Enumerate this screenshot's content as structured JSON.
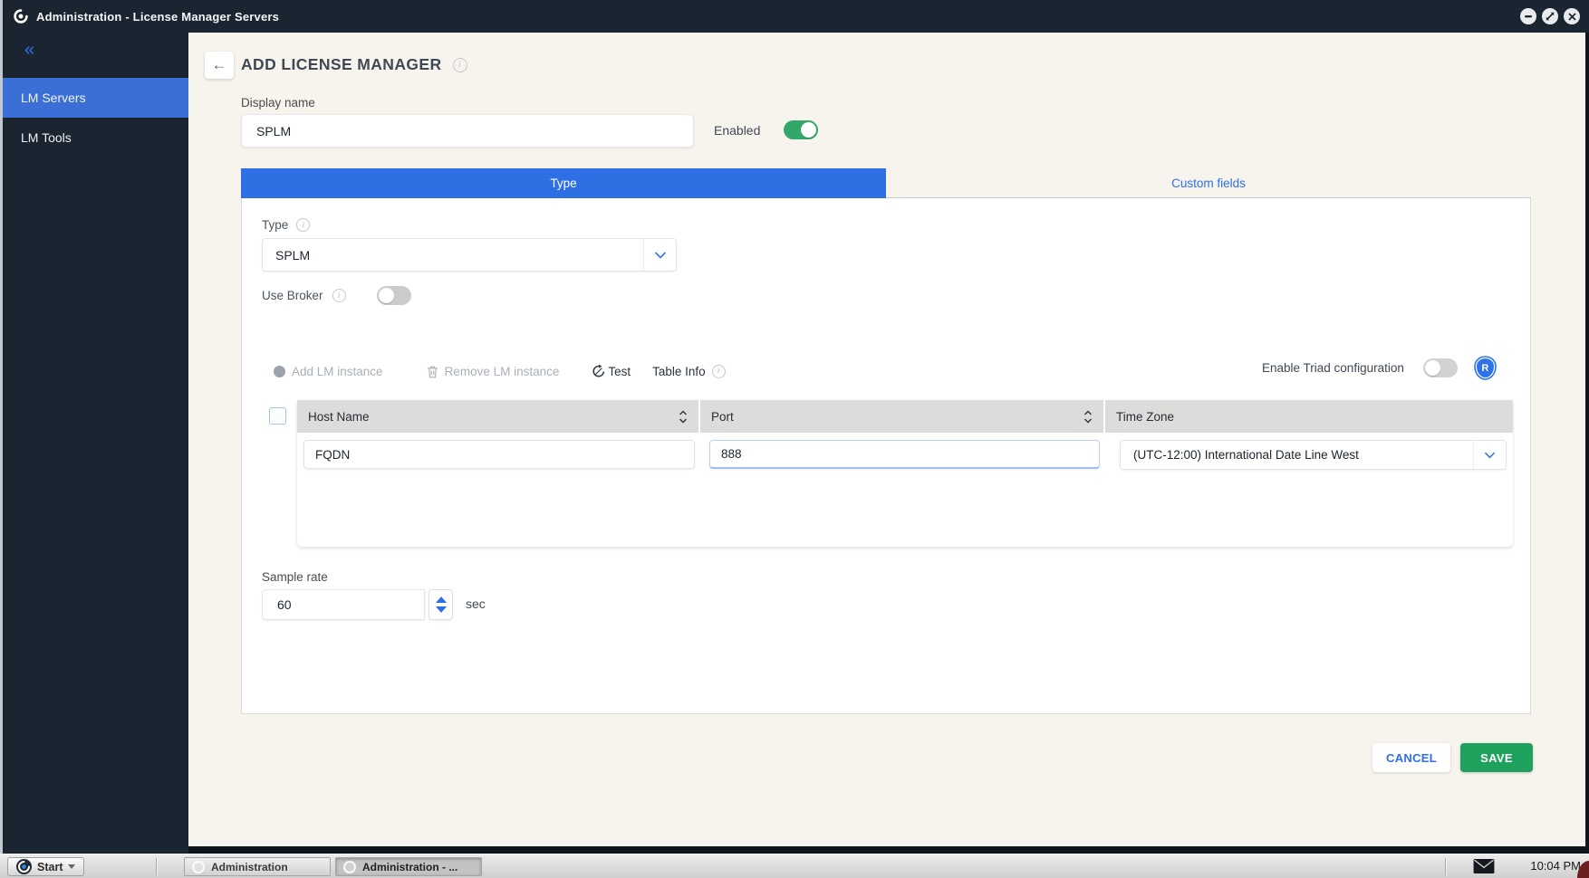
{
  "titlebar": {
    "title": "Administration - License Manager Servers"
  },
  "sidebar": {
    "items": [
      {
        "label": "LM Servers"
      },
      {
        "label": "LM Tools"
      }
    ]
  },
  "page": {
    "title": "ADD LICENSE MANAGER"
  },
  "form": {
    "display_name_label": "Display name",
    "display_name_value": "SPLM",
    "enabled_label": "Enabled",
    "tabs": [
      {
        "label": "Type"
      },
      {
        "label": "Custom fields"
      }
    ],
    "type_label": "Type",
    "type_value": "SPLM",
    "use_broker_label": "Use Broker",
    "toolbar": {
      "add_label": "Add LM instance",
      "remove_label": "Remove LM instance",
      "test_label": "Test",
      "table_info_label": "Table Info",
      "triad_label": "Enable Triad configuration"
    },
    "table": {
      "columns": [
        "Host Name",
        "Port",
        "Time Zone"
      ],
      "row": {
        "host_name": "FQDN",
        "port": "888",
        "time_zone": "(UTC-12:00) International Date Line West"
      }
    },
    "sample_rate_label": "Sample rate",
    "sample_rate_value": "60",
    "sample_rate_unit": "sec"
  },
  "actions": {
    "cancel": "CANCEL",
    "save": "SAVE"
  },
  "taskbar": {
    "start": "Start",
    "tasks": [
      {
        "label": "Administration"
      },
      {
        "label": "Administration - ..."
      }
    ],
    "clock": "10:04 PM"
  },
  "colors": {
    "accent_blue": "#2e6fe4",
    "sidebar_selected": "#3c6fd6",
    "toggle_green": "#33a669",
    "save_green": "#1fa05c",
    "chrome_dark": "#1b2531"
  }
}
